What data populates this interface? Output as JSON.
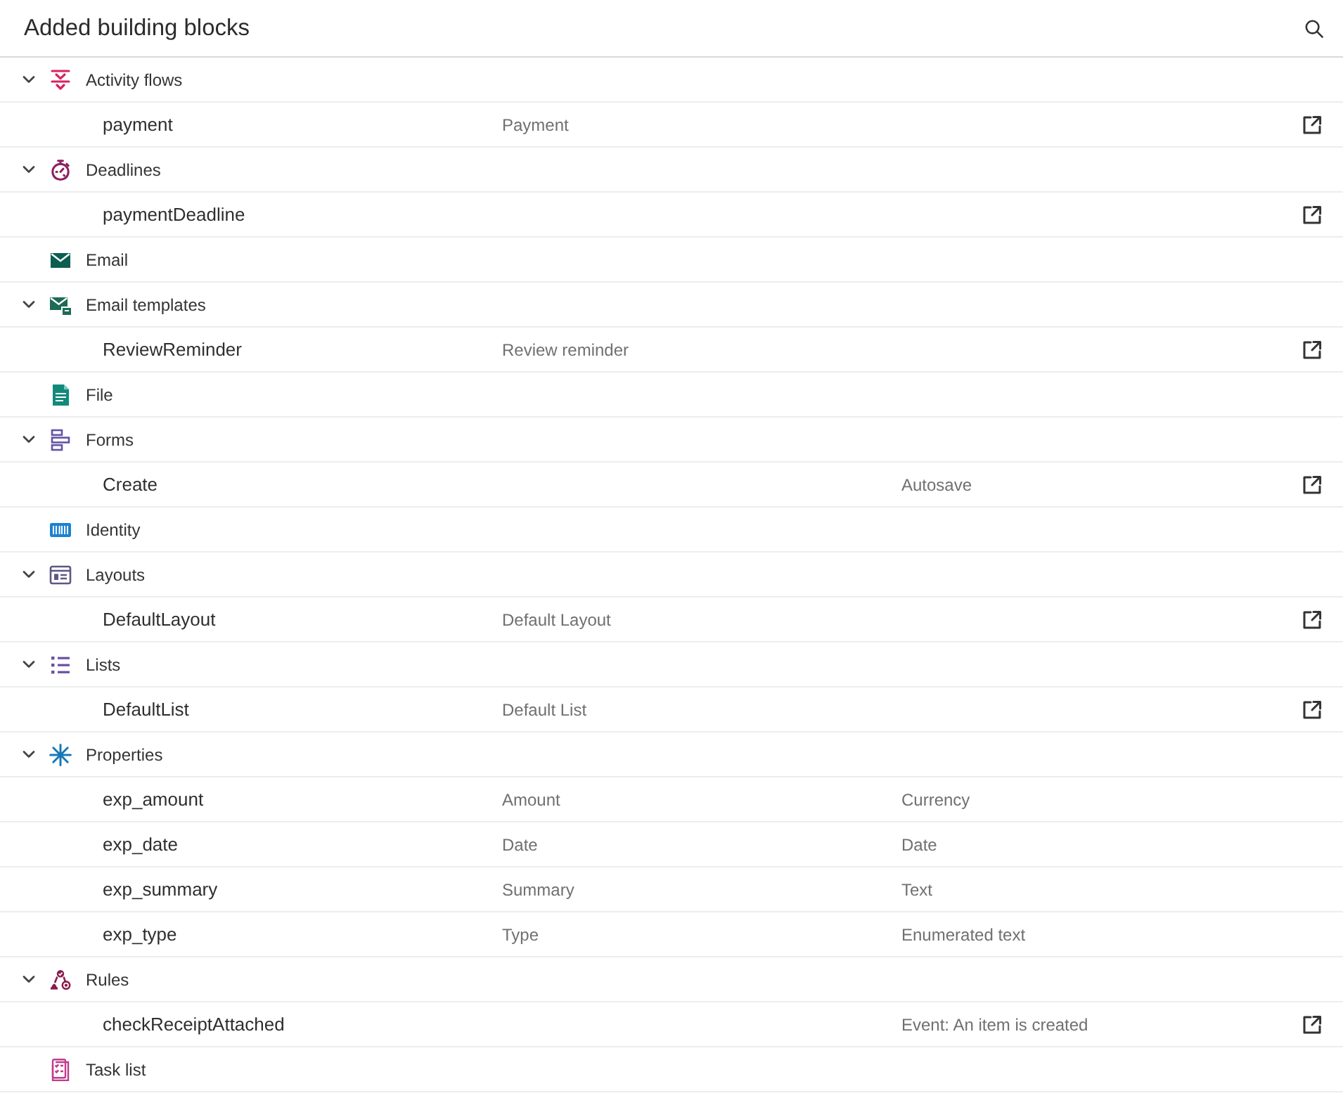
{
  "panel": {
    "title": "Added building blocks"
  },
  "groups": [
    {
      "kind": "activity-flows",
      "label": "Activity flows",
      "expanded": true,
      "children": [
        {
          "column_1": "payment",
          "column_2": "Payment",
          "open_action": true
        }
      ]
    },
    {
      "kind": "deadlines",
      "label": "Deadlines",
      "expanded": true,
      "children": [
        {
          "column_1": "paymentDeadline",
          "open_action": true
        }
      ]
    },
    {
      "kind": "email",
      "label": "Email"
    },
    {
      "kind": "email-templates",
      "label": "Email templates",
      "expanded": true,
      "children": [
        {
          "column_1": "ReviewReminder",
          "column_2": "Review reminder",
          "open_action": true
        }
      ]
    },
    {
      "kind": "file",
      "label": "File"
    },
    {
      "kind": "forms",
      "label": "Forms",
      "expanded": true,
      "children": [
        {
          "column_1": "Create",
          "column_3": "Autosave",
          "open_action": true
        }
      ]
    },
    {
      "kind": "identity",
      "label": "Identity"
    },
    {
      "kind": "layouts",
      "label": "Layouts",
      "expanded": true,
      "children": [
        {
          "column_1": "DefaultLayout",
          "column_2": "Default Layout",
          "open_action": true
        }
      ]
    },
    {
      "kind": "lists",
      "label": "Lists",
      "expanded": true,
      "children": [
        {
          "column_1": "DefaultList",
          "column_2": "Default List",
          "open_action": true
        }
      ]
    },
    {
      "kind": "properties",
      "label": "Properties",
      "expanded": true,
      "children": [
        {
          "column_1": "exp_amount",
          "column_2": "Amount",
          "column_3": "Currency",
          "open_action": false
        },
        {
          "column_1": "exp_date",
          "column_2": "Date",
          "column_3": "Date",
          "open_action": false
        },
        {
          "column_1": "exp_summary",
          "column_2": "Summary",
          "column_3": "Text",
          "open_action": false
        },
        {
          "column_1": "exp_type",
          "column_2": "Type",
          "column_3": "Enumerated text",
          "open_action": false
        }
      ]
    },
    {
      "kind": "rules",
      "label": "Rules",
      "expanded": true,
      "children": [
        {
          "column_1": "checkReceiptAttached",
          "column_3": "Event: An item is created",
          "open_action": true
        }
      ]
    },
    {
      "kind": "task-list",
      "label": "Task list"
    }
  ]
}
